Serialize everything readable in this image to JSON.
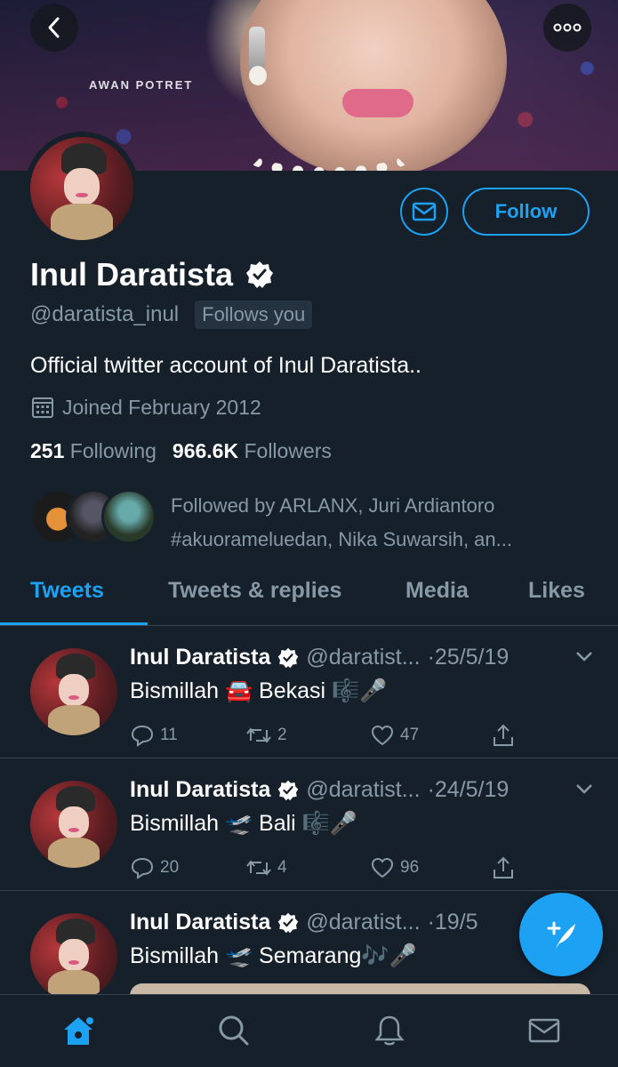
{
  "banner": {
    "watermark": "AWAN POTRET"
  },
  "profile": {
    "name": "Inul Daratista",
    "handle": "@daratista_inul",
    "follows_you": "Follows you",
    "bio": "Official twitter account of Inul Daratista..",
    "joined": "Joined February 2012",
    "following_count": "251",
    "following_label": "Following",
    "followers_count": "966.6K",
    "followers_label": "Followers",
    "followed_by_line1": "Followed by ARLANX, Juri Ardiantoro",
    "followed_by_line2": "#akuorameluedan, Nika Suwarsih, an..."
  },
  "buttons": {
    "follow": "Follow"
  },
  "tabs": [
    {
      "label": "Tweets",
      "active": true
    },
    {
      "label": "Tweets & replies",
      "active": false
    },
    {
      "label": "Media",
      "active": false
    },
    {
      "label": "Likes",
      "active": false
    }
  ],
  "tweets": [
    {
      "name": "Inul Daratista",
      "handle": "@daratist...",
      "date": "·25/5/19",
      "text": "Bismillah 🚘 Bekasi 🎼🎤",
      "replies": "11",
      "retweets": "2",
      "likes": "47"
    },
    {
      "name": "Inul Daratista",
      "handle": "@daratist...",
      "date": "·24/5/19",
      "text": "Bismillah 🛫 Bali 🎼🎤",
      "replies": "20",
      "retweets": "4",
      "likes": "96"
    },
    {
      "name": "Inul Daratista",
      "handle": "@daratist...",
      "date": "·19/5",
      "text": "Bismillah 🛫 Semarang🎶🎤",
      "replies": "",
      "retweets": "",
      "likes": ""
    }
  ],
  "colors": {
    "background": "#15202b",
    "accent": "#1da1f2",
    "muted": "#8899a6",
    "divider": "#38444d"
  },
  "icons": {
    "back": "chevron-left-icon",
    "more": "more-icon",
    "mail": "mail-icon",
    "verified": "verified-badge-icon",
    "calendar": "calendar-icon",
    "reply": "reply-icon",
    "retweet": "retweet-icon",
    "like": "heart-icon",
    "share": "share-icon",
    "compose": "compose-tweet-icon",
    "home": "home-icon",
    "search": "search-icon",
    "notifications": "bell-icon",
    "messages": "mail-icon"
  }
}
